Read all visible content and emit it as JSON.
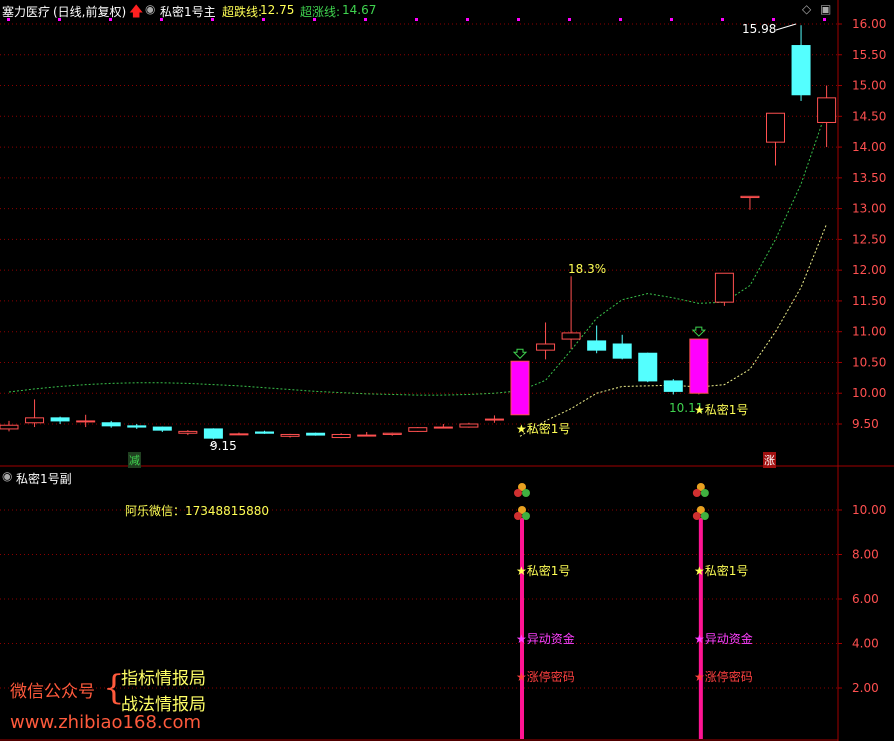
{
  "header": {
    "stock_title": "塞力医疗",
    "period_label": "(日线,前复权)",
    "indicator_name": "私密1号主",
    "super_fall_label": "超跌线:",
    "super_fall_value": "12.75",
    "super_rise_label": "超涨线:",
    "super_rise_value": "14.67"
  },
  "sub_panel": {
    "title": "私密1号副",
    "contact": "阿乐微信：17348815880",
    "y_ticks": [
      "10.00",
      "8.00",
      "6.00",
      "4.00",
      "2.00"
    ]
  },
  "main_axis": {
    "y_ticks": [
      "16.00",
      "15.50",
      "15.00",
      "14.50",
      "14.00",
      "13.50",
      "13.00",
      "12.50",
      "12.00",
      "11.50",
      "11.00",
      "10.50",
      "10.00",
      "9.50"
    ]
  },
  "annotations": {
    "high_price": "15.98",
    "low_price": "9.15",
    "pct_change": "18.3%",
    "low2_price": "10.11",
    "signal_label": "★私密1号",
    "signal_label_sub": "★私密1号",
    "fund_label": "★异动资金",
    "limit_label": "★涨停密码",
    "badge_reduce": "减",
    "badge_rise": "涨"
  },
  "watermark": {
    "wechat_label": "微信公众号",
    "name1": "指标情报局",
    "name2": "战法情报局",
    "url": "www.zhibiao168.com"
  },
  "colors": {
    "up": "#ff5050",
    "down": "#54ffff",
    "signal_bar": "#ff00ff",
    "ma_green": "#39c04a",
    "ma_yellow": "#f0f08c",
    "grid": "#8b0000",
    "text_yellow": "#ffff55",
    "text_green": "#3fd34f"
  },
  "chart_data": {
    "type": "candlestick",
    "ylim": [
      9.3,
      16.2
    ],
    "candles": [
      {
        "o": 9.42,
        "h": 9.55,
        "l": 9.38,
        "c": 9.48
      },
      {
        "o": 9.52,
        "h": 9.9,
        "l": 9.45,
        "c": 9.6
      },
      {
        "o": 9.6,
        "h": 9.62,
        "l": 9.5,
        "c": 9.55
      },
      {
        "o": 9.55,
        "h": 9.65,
        "l": 9.45,
        "c": 9.55
      },
      {
        "o": 9.52,
        "h": 9.55,
        "l": 9.44,
        "c": 9.47
      },
      {
        "o": 9.47,
        "h": 9.5,
        "l": 9.42,
        "c": 9.45
      },
      {
        "o": 9.45,
        "h": 9.46,
        "l": 9.37,
        "c": 9.4
      },
      {
        "o": 9.35,
        "h": 9.4,
        "l": 9.32,
        "c": 9.38
      },
      {
        "o": 9.42,
        "h": 9.43,
        "l": 9.25,
        "c": 9.27
      },
      {
        "o": 9.34,
        "h": 9.36,
        "l": 9.32,
        "c": 9.34
      },
      {
        "o": 9.37,
        "h": 9.39,
        "l": 9.34,
        "c": 9.35
      },
      {
        "o": 9.3,
        "h": 9.34,
        "l": 9.28,
        "c": 9.33
      },
      {
        "o": 9.35,
        "h": 9.36,
        "l": 9.31,
        "c": 9.32
      },
      {
        "o": 9.28,
        "h": 9.35,
        "l": 9.27,
        "c": 9.33
      },
      {
        "o": 9.32,
        "h": 9.37,
        "l": 9.3,
        "c": 9.32
      },
      {
        "o": 9.33,
        "h": 9.36,
        "l": 9.31,
        "c": 9.35
      },
      {
        "o": 9.38,
        "h": 9.45,
        "l": 9.37,
        "c": 9.44
      },
      {
        "o": 9.45,
        "h": 9.5,
        "l": 9.43,
        "c": 9.45
      },
      {
        "o": 9.45,
        "h": 9.52,
        "l": 9.44,
        "c": 9.5
      },
      {
        "o": 9.57,
        "h": 9.64,
        "l": 9.52,
        "c": 9.58
      },
      {
        "o": 9.65,
        "h": 10.52,
        "l": 9.65,
        "c": 10.52
      },
      {
        "o": 10.7,
        "h": 11.15,
        "l": 10.55,
        "c": 10.8
      },
      {
        "o": 10.88,
        "h": 11.9,
        "l": 10.72,
        "c": 10.98
      },
      {
        "o": 10.85,
        "h": 11.1,
        "l": 10.65,
        "c": 10.7
      },
      {
        "o": 10.8,
        "h": 10.95,
        "l": 10.55,
        "c": 10.57
      },
      {
        "o": 10.65,
        "h": 10.66,
        "l": 10.18,
        "c": 10.2
      },
      {
        "o": 10.2,
        "h": 10.23,
        "l": 9.98,
        "c": 10.03
      },
      {
        "o": 10.0,
        "h": 10.88,
        "l": 9.98,
        "c": 10.88
      },
      {
        "o": 11.48,
        "h": 11.95,
        "l": 11.42,
        "c": 11.95
      },
      {
        "o": 13.18,
        "h": 13.2,
        "l": 12.98,
        "c": 13.2
      },
      {
        "o": 14.08,
        "h": 14.55,
        "l": 13.7,
        "c": 14.55
      },
      {
        "o": 15.65,
        "h": 15.98,
        "l": 14.75,
        "c": 14.85
      },
      {
        "o": 14.4,
        "h": 15.0,
        "l": 14.0,
        "c": 14.8
      }
    ],
    "ma_green": [
      10.02,
      10.07,
      10.11,
      10.14,
      10.16,
      10.17,
      10.17,
      10.16,
      10.14,
      10.12,
      10.09,
      10.06,
      10.03,
      10.01,
      9.99,
      9.98,
      9.97,
      9.97,
      9.98,
      10.0,
      10.04,
      10.21,
      10.7,
      11.22,
      11.52,
      11.62,
      11.55,
      11.46,
      11.48,
      11.75,
      12.5,
      13.4,
      14.6
    ],
    "ma_yellow_start": 20,
    "ma_yellow": [
      9.3,
      9.55,
      9.75,
      10.0,
      10.11,
      10.12,
      10.13,
      10.1,
      10.14,
      10.39,
      11.0,
      11.72,
      12.75
    ],
    "signal_candles": [
      20,
      27
    ],
    "sub_ylim": [
      0,
      11.5
    ]
  }
}
